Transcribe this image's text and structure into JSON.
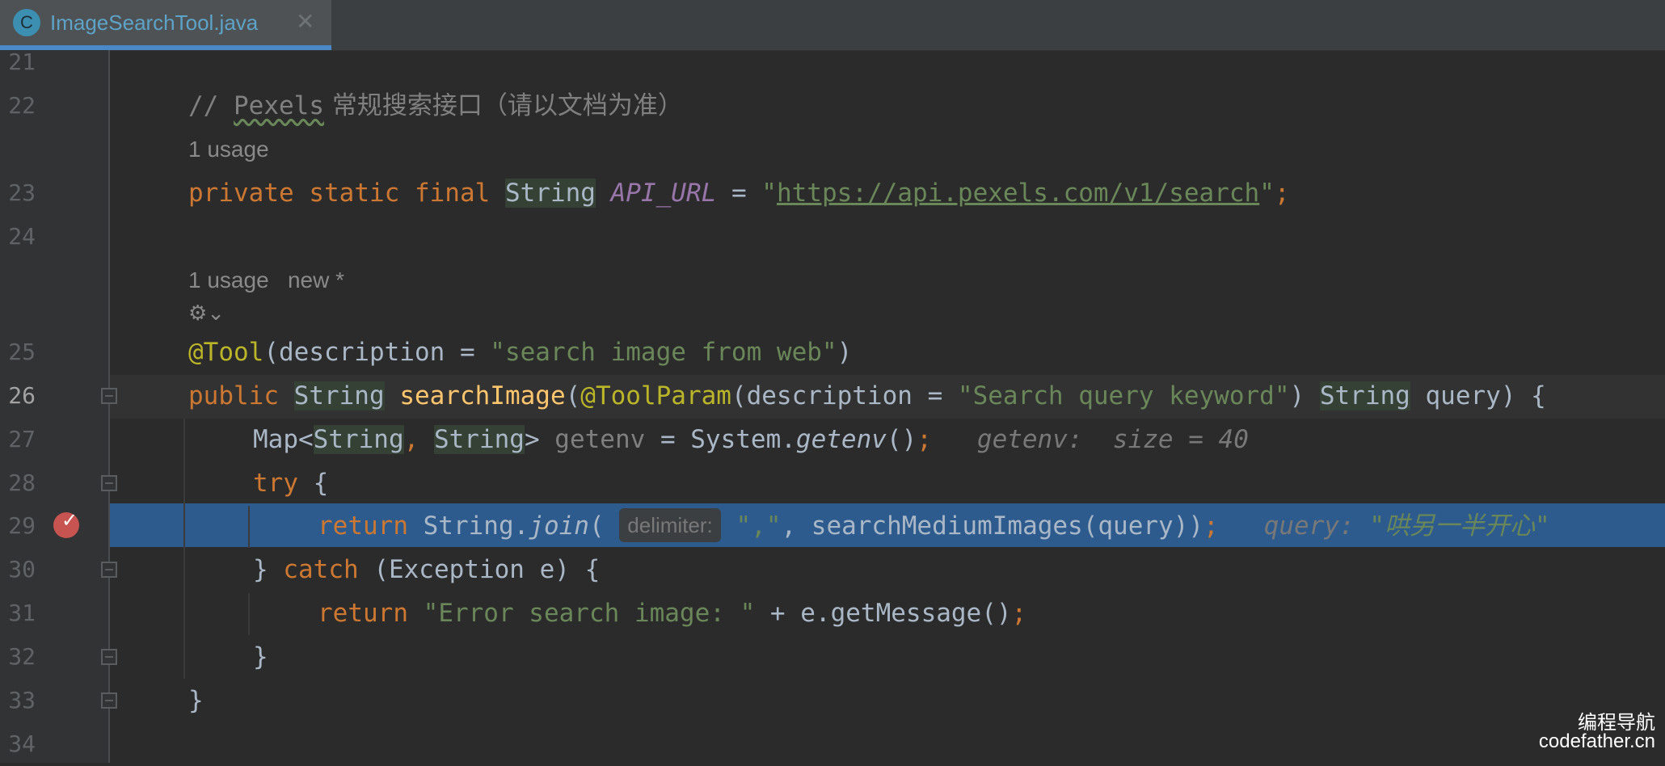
{
  "tab": {
    "icon_letter": "C",
    "title": "ImageSearchTool.java",
    "close_glyph": "✕"
  },
  "lines": {
    "l21": "21",
    "l22": "22",
    "l23": "23",
    "l24": "24",
    "l25": "25",
    "l26": "26",
    "l27": "27",
    "l28": "28",
    "l29": "29",
    "l30": "30",
    "l31": "31",
    "l32": "32",
    "l33": "33",
    "l34": "34"
  },
  "code": {
    "comment_slashes": "// ",
    "comment_word": "Pexels",
    "comment_rest": " 常规搜索接口（请以文档为准）",
    "hint_usage_1": "1 usage",
    "private": "private",
    "static": "static",
    "final": "final",
    "string_type": "String",
    "api_url_name": "API_URL",
    "eq": " = ",
    "quote": "\"",
    "api_url_value": "https://api.pexels.com/v1/search",
    "semicolon": ";",
    "hint_usage_2": "1 usage   new *",
    "tool_annotation": "@Tool",
    "tool_args_open": "(description = ",
    "tool_desc": "\"search image from web\"",
    "close_paren": ")",
    "public": "public",
    "method_name": "searchImage",
    "open_paren": "(",
    "toolparam_annotation": "@ToolParam",
    "param_desc": "\"Search query keyword\"",
    "param_name": " query) {",
    "map_type": "Map<",
    "comma": ", ",
    "gt": ">",
    "getenv_var": " getenv",
    "system_call": " = System.",
    "getenv_method": "getenv",
    "call_end": "()",
    "debug_getenv_label": "getenv:",
    "debug_getenv_value": "size = 40",
    "try": "try",
    "brace_open": " {",
    "return": "return",
    "string_dot": " String.",
    "join": "join",
    "delimiter_hint": "delimiter:",
    "delim_value": "\",\"",
    "search_medium": ", searchMediumImages(query))",
    "debug_query_label": "query:",
    "debug_query_value": "\"哄另一半开心\"",
    "catch_open": "} ",
    "catch": "catch",
    "exception": " (Exception e) {",
    "error_string": "\"Error search image: \"",
    "get_message": " + e.getMessage()",
    "close_brace": "}"
  },
  "watermark": {
    "line1": "编程导航",
    "line2": "codefather.cn"
  }
}
